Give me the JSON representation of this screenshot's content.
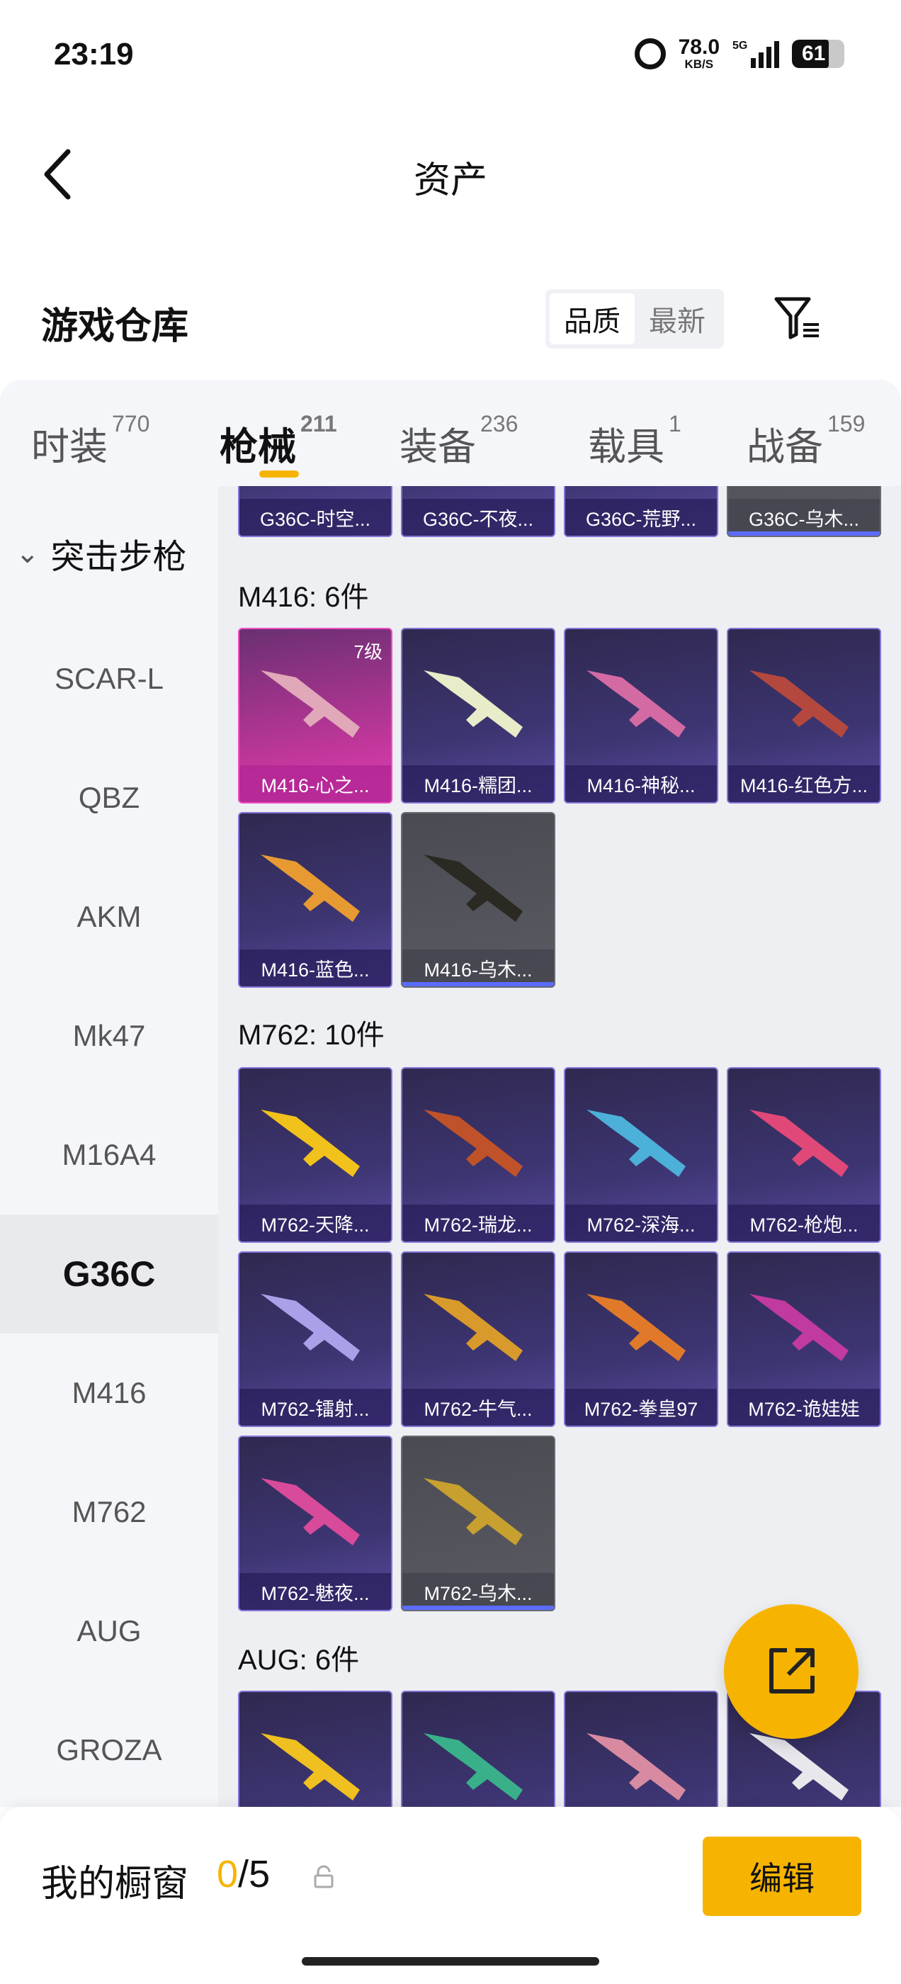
{
  "status": {
    "time": "23:19",
    "net_speed": "78.0",
    "net_unit": "KB/S",
    "network": "5G",
    "battery": "61"
  },
  "nav": {
    "title": "资产"
  },
  "header": {
    "title": "游戏仓库",
    "sort_options": [
      "品质",
      "最新"
    ]
  },
  "tabs": [
    {
      "label": "时装",
      "count": "770"
    },
    {
      "label": "枪械",
      "count": "211"
    },
    {
      "label": "装备",
      "count": "236"
    },
    {
      "label": "载具",
      "count": "1"
    },
    {
      "label": "战备",
      "count": "159"
    }
  ],
  "sidebar": {
    "group": "突击步枪",
    "items": [
      "SCAR-L",
      "QBZ",
      "AKM",
      "Mk47",
      "M16A4",
      "G36C",
      "M416",
      "M762",
      "AUG",
      "GROZA"
    ],
    "active": "G36C"
  },
  "content": {
    "top_row": [
      "G36C-时空...",
      "G36C-不夜...",
      "G36C-荒野...",
      "G36C-乌木..."
    ],
    "groups": [
      {
        "title": "M416: 6件",
        "items": [
          {
            "name": "M416-心之...",
            "level": "7级"
          },
          {
            "name": "M416-糯团..."
          },
          {
            "name": "M416-神秘..."
          },
          {
            "name": "M416-红色方..."
          },
          {
            "name": "M416-蓝色..."
          },
          {
            "name": "M416-乌木..."
          }
        ]
      },
      {
        "title": "M762: 10件",
        "items": [
          {
            "name": "M762-天降..."
          },
          {
            "name": "M762-瑞龙..."
          },
          {
            "name": "M762-深海..."
          },
          {
            "name": "M762-枪炮..."
          },
          {
            "name": "M762-镭射..."
          },
          {
            "name": "M762-牛气..."
          },
          {
            "name": "M762-拳皇97"
          },
          {
            "name": "M762-诡娃娃"
          },
          {
            "name": "M762-魅夜..."
          },
          {
            "name": "M762-乌木..."
          }
        ]
      },
      {
        "title": "AUG: 6件",
        "items": []
      }
    ]
  },
  "bottom": {
    "label": "我的橱窗",
    "count_current": "0",
    "count_sep": "/",
    "count_total": "5",
    "edit_label": "编辑"
  },
  "colors": {
    "accent": "#f6b400"
  }
}
